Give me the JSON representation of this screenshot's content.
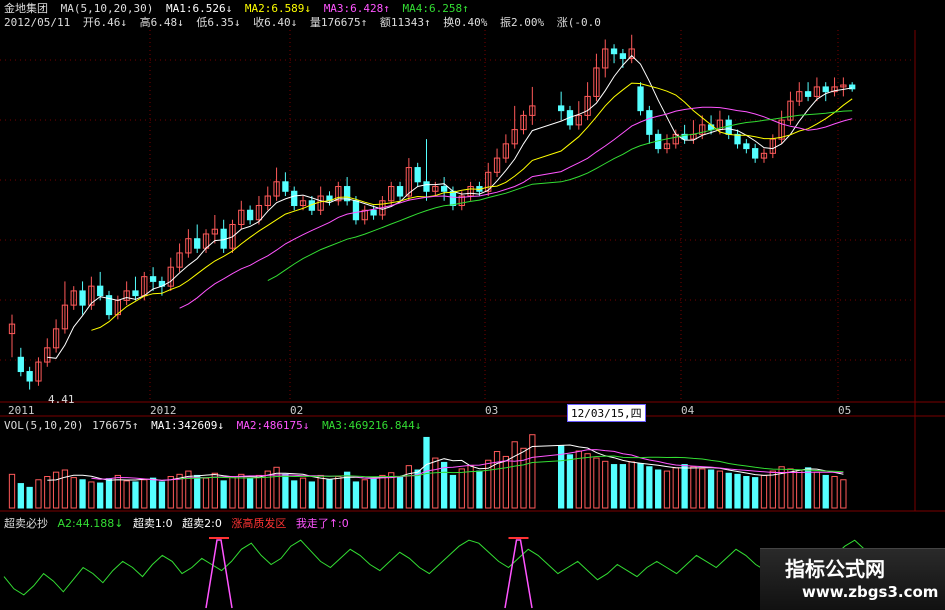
{
  "header": {
    "stock": "金地集团",
    "ma_label": "MA(5,10,20,30)",
    "ma1": "MA1:6.526↓",
    "ma2": "MA2:6.589↓",
    "ma3": "MA3:6.428↑",
    "ma4": "MA4:6.258↑",
    "date": "2012/05/11",
    "open": "开6.46↓",
    "high": "高6.48↓",
    "low": "低6.35↓",
    "close": "收6.40↓",
    "vol": "量176675↑",
    "amount": "额11343↑",
    "turnover": "换0.40%",
    "amplitude": "振2.00%",
    "change": "涨(-0.0"
  },
  "colors": {
    "up": "#ff5a5a",
    "down": "#55ffff",
    "ma1": "#ffffff",
    "ma2": "#ffff00",
    "ma3": "#ff55ff",
    "ma4": "#33dd33",
    "grid": "#7a0000"
  },
  "axis": {
    "low_label": "4.41",
    "x_labels": [
      "2011",
      "2012",
      "02",
      "03",
      "12/03/15,四",
      "04",
      "05"
    ]
  },
  "vol_header": {
    "label": "VOL(5,10,20)",
    "value": "176675↑",
    "ma1": "MA1:342609↓",
    "ma2": "MA2:486175↓",
    "ma3": "MA3:469216.844↓"
  },
  "ind_header": {
    "name": "超卖必抄",
    "a2": "A2:44.188↓",
    "s1": "超卖1:0",
    "s2": "超卖2:0",
    "zone": "涨高质发区",
    "gone": "我走了↑:0"
  },
  "watermark": {
    "title": "指标公式网",
    "url": "www.zbgs3.com"
  },
  "chart_data": {
    "type": "candlestick",
    "price_ylim": [
      4.3,
      8.2
    ],
    "candles": [
      [
        5.0,
        5.1,
        4.75,
        5.2
      ],
      [
        4.75,
        4.6,
        4.55,
        4.85
      ],
      [
        4.6,
        4.5,
        4.41,
        4.65
      ],
      [
        4.5,
        4.7,
        4.45,
        4.75
      ],
      [
        4.7,
        4.85,
        4.65,
        4.95
      ],
      [
        4.85,
        5.05,
        4.8,
        5.15
      ],
      [
        5.05,
        5.3,
        5.0,
        5.55
      ],
      [
        5.3,
        5.45,
        5.25,
        5.5
      ],
      [
        5.45,
        5.3,
        5.2,
        5.55
      ],
      [
        5.3,
        5.5,
        5.25,
        5.6
      ],
      [
        5.5,
        5.4,
        5.35,
        5.65
      ],
      [
        5.4,
        5.2,
        5.15,
        5.45
      ],
      [
        5.2,
        5.35,
        5.15,
        5.4
      ],
      [
        5.35,
        5.45,
        5.3,
        5.55
      ],
      [
        5.45,
        5.4,
        5.35,
        5.6
      ],
      [
        5.4,
        5.6,
        5.35,
        5.65
      ],
      [
        5.6,
        5.55,
        5.45,
        5.7
      ],
      [
        5.55,
        5.5,
        5.4,
        5.6
      ],
      [
        5.5,
        5.7,
        5.45,
        5.8
      ],
      [
        5.7,
        5.85,
        5.65,
        5.95
      ],
      [
        5.85,
        6.0,
        5.8,
        6.1
      ],
      [
        6.0,
        5.9,
        5.85,
        6.15
      ],
      [
        5.9,
        6.05,
        5.85,
        6.1
      ],
      [
        6.05,
        6.1,
        5.95,
        6.25
      ],
      [
        6.1,
        5.9,
        5.85,
        6.2
      ],
      [
        5.9,
        6.15,
        5.85,
        6.2
      ],
      [
        6.15,
        6.3,
        6.1,
        6.4
      ],
      [
        6.3,
        6.2,
        6.15,
        6.35
      ],
      [
        6.2,
        6.35,
        6.15,
        6.45
      ],
      [
        6.35,
        6.45,
        6.3,
        6.55
      ],
      [
        6.45,
        6.6,
        6.4,
        6.75
      ],
      [
        6.6,
        6.5,
        6.45,
        6.7
      ],
      [
        6.5,
        6.35,
        6.3,
        6.55
      ],
      [
        6.35,
        6.4,
        6.3,
        6.45
      ],
      [
        6.4,
        6.3,
        6.25,
        6.45
      ],
      [
        6.3,
        6.45,
        6.25,
        6.55
      ],
      [
        6.45,
        6.4,
        6.35,
        6.5
      ],
      [
        6.4,
        6.55,
        6.35,
        6.6
      ],
      [
        6.55,
        6.4,
        6.35,
        6.65
      ],
      [
        6.4,
        6.2,
        6.15,
        6.45
      ],
      [
        6.2,
        6.3,
        6.15,
        6.35
      ],
      [
        6.3,
        6.25,
        6.2,
        6.35
      ],
      [
        6.25,
        6.4,
        6.2,
        6.45
      ],
      [
        6.4,
        6.55,
        6.35,
        6.6
      ],
      [
        6.55,
        6.45,
        6.4,
        6.6
      ],
      [
        6.45,
        6.75,
        6.4,
        6.85
      ],
      [
        6.75,
        6.6,
        6.55,
        6.8
      ],
      [
        6.6,
        6.5,
        6.4,
        7.05
      ],
      [
        6.5,
        6.55,
        6.45,
        6.6
      ],
      [
        6.55,
        6.5,
        6.4,
        6.65
      ],
      [
        6.5,
        6.35,
        6.3,
        6.55
      ],
      [
        6.35,
        6.45,
        6.3,
        6.5
      ],
      [
        6.45,
        6.55,
        6.4,
        6.6
      ],
      [
        6.55,
        6.5,
        6.45,
        6.6
      ],
      [
        6.5,
        6.7,
        6.45,
        6.8
      ],
      [
        6.7,
        6.85,
        6.65,
        6.95
      ],
      [
        6.85,
        7.0,
        6.8,
        7.1
      ],
      [
        7.0,
        7.15,
        6.95,
        7.4
      ],
      [
        7.15,
        7.3,
        7.1,
        7.35
      ],
      [
        7.3,
        7.4,
        7.2,
        7.6
      ],
      [
        7.4,
        7.35,
        7.25,
        7.55
      ],
      [
        7.35,
        7.2,
        7.15,
        7.4
      ],
      [
        7.2,
        7.3,
        7.15,
        7.45
      ],
      [
        7.3,
        7.5,
        7.25,
        7.65
      ],
      [
        7.5,
        7.8,
        7.45,
        7.95
      ],
      [
        7.8,
        8.0,
        7.7,
        8.1
      ],
      [
        8.0,
        7.95,
        7.85,
        8.05
      ],
      [
        7.95,
        7.9,
        7.8,
        8.0
      ],
      [
        7.9,
        8.0,
        7.85,
        8.15
      ],
      [
        7.6,
        7.35,
        7.3,
        7.65
      ],
      [
        7.35,
        7.1,
        7.0,
        7.4
      ],
      [
        7.1,
        6.95,
        6.9,
        7.15
      ],
      [
        6.95,
        7.0,
        6.9,
        7.1
      ],
      [
        7.0,
        7.1,
        6.95,
        7.15
      ],
      [
        7.1,
        7.05,
        7.0,
        7.2
      ],
      [
        7.05,
        7.1,
        7.0,
        7.25
      ],
      [
        7.1,
        7.2,
        7.05,
        7.3
      ],
      [
        7.2,
        7.15,
        7.1,
        7.3
      ],
      [
        7.15,
        7.25,
        7.1,
        7.35
      ],
      [
        7.25,
        7.1,
        7.05,
        7.3
      ],
      [
        7.1,
        7.0,
        6.95,
        7.15
      ],
      [
        7.0,
        6.95,
        6.9,
        7.05
      ],
      [
        6.95,
        6.85,
        6.8,
        7.0
      ],
      [
        6.85,
        6.9,
        6.8,
        6.95
      ],
      [
        6.9,
        7.05,
        6.85,
        7.1
      ],
      [
        7.05,
        7.25,
        7.0,
        7.35
      ],
      [
        7.25,
        7.45,
        7.2,
        7.55
      ],
      [
        7.45,
        7.55,
        7.4,
        7.65
      ],
      [
        7.55,
        7.5,
        7.45,
        7.65
      ],
      [
        7.5,
        7.6,
        7.45,
        7.7
      ],
      [
        7.6,
        7.55,
        7.45,
        7.65
      ],
      [
        7.55,
        7.6,
        7.5,
        7.7
      ],
      [
        7.6,
        7.62,
        7.5,
        7.7
      ],
      [
        7.62,
        7.58,
        7.55,
        7.65
      ]
    ],
    "volumes": [
      62,
      45,
      38,
      52,
      58,
      66,
      70,
      56,
      52,
      48,
      46,
      54,
      60,
      50,
      48,
      52,
      55,
      48,
      58,
      62,
      68,
      60,
      55,
      64,
      50,
      58,
      62,
      55,
      60,
      68,
      75,
      62,
      50,
      55,
      48,
      60,
      52,
      58,
      66,
      48,
      52,
      55,
      60,
      65,
      58,
      78,
      70,
      130,
      92,
      84,
      60,
      72,
      78,
      68,
      88,
      104,
      95,
      122,
      110,
      135,
      115,
      98,
      105,
      100,
      92,
      86,
      80,
      80,
      85,
      82,
      76,
      70,
      68,
      74,
      80,
      76,
      72,
      70,
      68,
      64,
      62,
      58,
      56,
      60,
      68,
      76,
      72,
      70,
      74,
      66,
      60,
      58,
      52
    ],
    "indicator": [
      38,
      30,
      26,
      32,
      40,
      35,
      28,
      36,
      44,
      40,
      34,
      42,
      48,
      44,
      38,
      46,
      52,
      48,
      40,
      44,
      50,
      46,
      42,
      48,
      56,
      60,
      52,
      46,
      50,
      58,
      62,
      55,
      48,
      44,
      50,
      56,
      52,
      46,
      42,
      48,
      54,
      50,
      44,
      40,
      46,
      52,
      58,
      62,
      60,
      54,
      48,
      44,
      50,
      56,
      52,
      46,
      40,
      44,
      48,
      42,
      36,
      40,
      46,
      42,
      38,
      44,
      48,
      44,
      40,
      46,
      52,
      48,
      44,
      50,
      56,
      52,
      46,
      42,
      48,
      54,
      50,
      44,
      40,
      46,
      52,
      58,
      62,
      56,
      50,
      46,
      44,
      48
    ],
    "spikes": [
      {
        "from": 206,
        "to": 232,
        "label": ""
      },
      {
        "from": 505,
        "to": 532,
        "label": ""
      }
    ]
  }
}
